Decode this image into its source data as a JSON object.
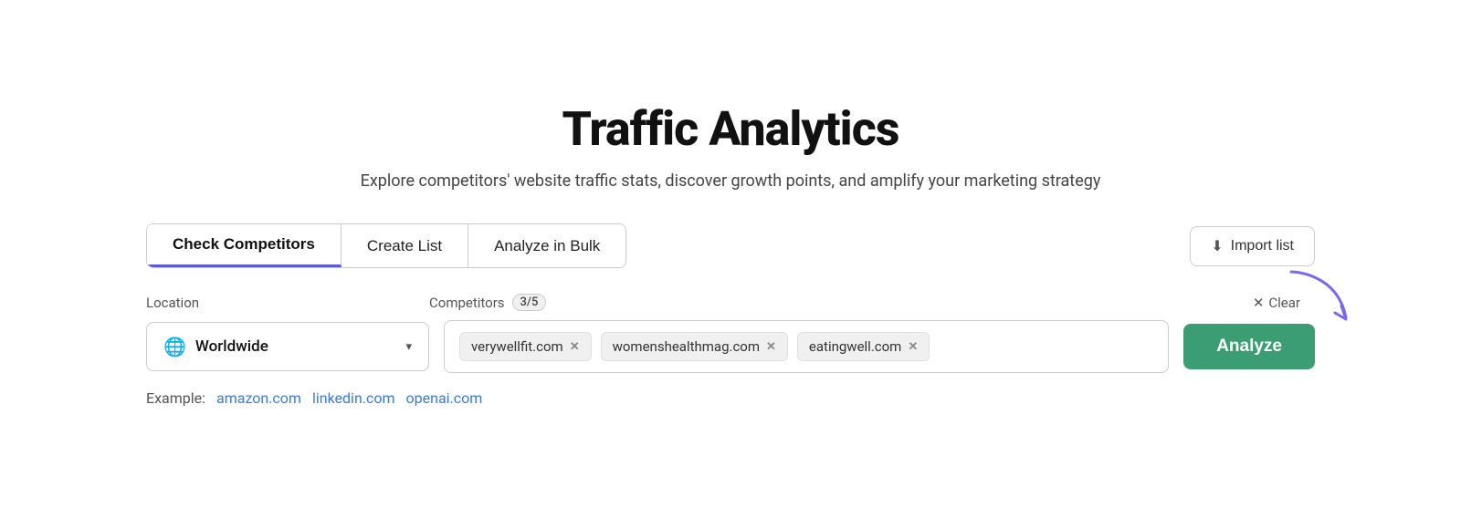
{
  "page": {
    "title": "Traffic Analytics",
    "subtitle": "Explore competitors' website traffic stats, discover growth points, and amplify your marketing strategy"
  },
  "tabs": {
    "items": [
      {
        "label": "Check Competitors",
        "active": true
      },
      {
        "label": "Create List",
        "active": false
      },
      {
        "label": "Analyze in Bulk",
        "active": false
      }
    ],
    "import_button": "Import list"
  },
  "form": {
    "location_label": "Location",
    "competitors_label": "Competitors",
    "competitors_count": "3/5",
    "clear_label": "Clear",
    "location_value": "Worldwide",
    "tags": [
      {
        "value": "verywellfit.com"
      },
      {
        "value": "womenshealthmag.com"
      },
      {
        "value": "eatingwell.com"
      }
    ],
    "analyze_button": "Analyze"
  },
  "examples": {
    "label": "Example:",
    "links": [
      "amazon.com",
      "linkedin.com",
      "openai.com"
    ]
  }
}
